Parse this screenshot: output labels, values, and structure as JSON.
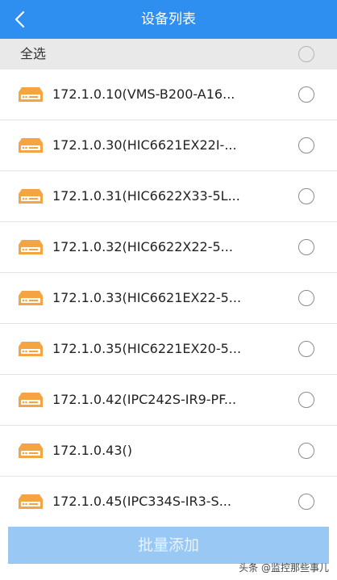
{
  "header": {
    "title": "设备列表"
  },
  "select_all": {
    "label": "全选",
    "checked": false
  },
  "devices": [
    {
      "name": "172.1.0.10(VMS-B200-A16...",
      "checked": false
    },
    {
      "name": "172.1.0.30(HIC6621EX22I-...",
      "checked": false
    },
    {
      "name": "172.1.0.31(HIC6622X33-5L...",
      "checked": false
    },
    {
      "name": "172.1.0.32(HIC6622X22-5...",
      "checked": false
    },
    {
      "name": "172.1.0.33(HIC6621EX22-5...",
      "checked": false
    },
    {
      "name": "172.1.0.35(HIC6221EX20-5...",
      "checked": false
    },
    {
      "name": "172.1.0.42(IPC242S-IR9-PF...",
      "checked": false
    },
    {
      "name": "172.1.0.43()",
      "checked": false
    },
    {
      "name": "172.1.0.45(IPC334S-IR3-S...",
      "checked": false
    }
  ],
  "footer": {
    "batch_add_label": "批量添加",
    "watermark": "头条 @监控那些事儿"
  },
  "colors": {
    "header_bg": "#2f8ff0",
    "device_icon": "#f5a442",
    "button_bg": "#99c8f5"
  },
  "icons": {
    "back": "chevron-left-icon",
    "device": "nvr-device-icon"
  }
}
